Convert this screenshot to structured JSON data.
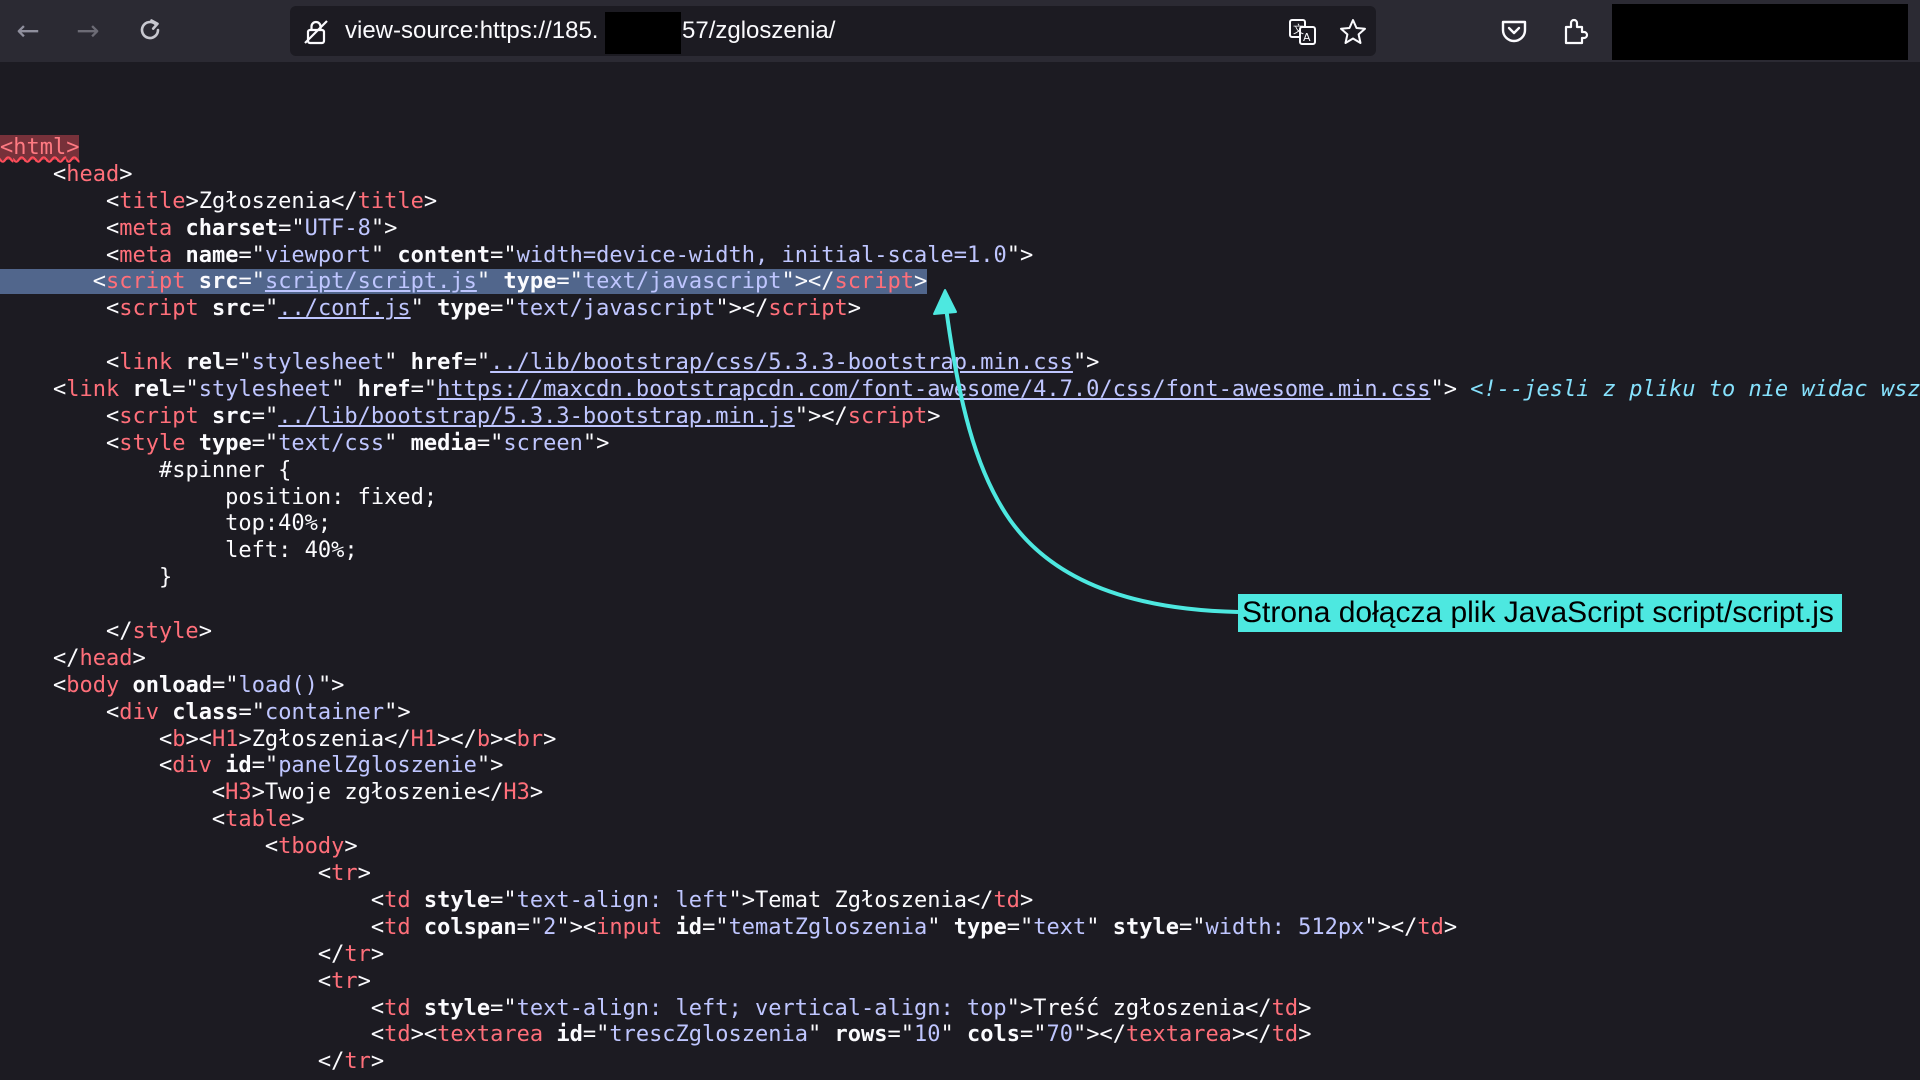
{
  "browser": {
    "url_prefix": "view-source:https://185.",
    "url_suffix": "57/zgloszenia/"
  },
  "icons": {
    "back": "arrow-left-icon",
    "forward": "arrow-right-icon",
    "reload": "reload-icon",
    "lock": "lock-icon",
    "translate": "translate-icon",
    "bookmark": "star-icon",
    "pocket": "pocket-icon",
    "extensions": "extensions-icon"
  },
  "source": {
    "title_text": "Zgłoszenia",
    "charset": "UTF-8",
    "viewport_name": "viewport",
    "viewport_content": "width=device-width, initial-scale=1.0",
    "script1_src": "script/script.js",
    "script_type": "text/javascript",
    "script2_src": "../conf.js",
    "stylesheet": "stylesheet",
    "bootstrap_css": "../lib/bootstrap/css/5.3.3-bootstrap.min.css",
    "fa_css": "https://maxcdn.bootstrapcdn.com/font-awesome/4.7.0/css/font-awesome.min.css",
    "comment": "<!--jesli z pliku to nie widac wszy",
    "bootstrap_js": "../lib/bootstrap/5.3.3-bootstrap.min.js",
    "style_type": "text/css",
    "style_media": "screen",
    "css_selector": "#spinner {",
    "css_position": "position: fixed;",
    "css_top": "top:40%;",
    "css_left": "left: 40%;",
    "css_close": "}",
    "onload": "load()",
    "container_class": "container",
    "h1_text": "Zgłoszenia",
    "panel_id": "panelZgloszenie",
    "h3_text": "Twoje zgłoszenie",
    "td1_style": "text-align: left",
    "td1_text": "Temat Zgłoszenia",
    "colspan": "2",
    "input_id": "tematZgloszenia",
    "input_type": "text",
    "input_style": "width: 512px",
    "td2_style": "text-align: left; vertical-align: top",
    "td2_text": "Treść zgłoszenia",
    "textarea_id": "trescZgloszenia",
    "rows": "10",
    "cols": "70"
  },
  "annotation": {
    "callout": "Strona dołącza plik JavaScript script/script.js"
  }
}
